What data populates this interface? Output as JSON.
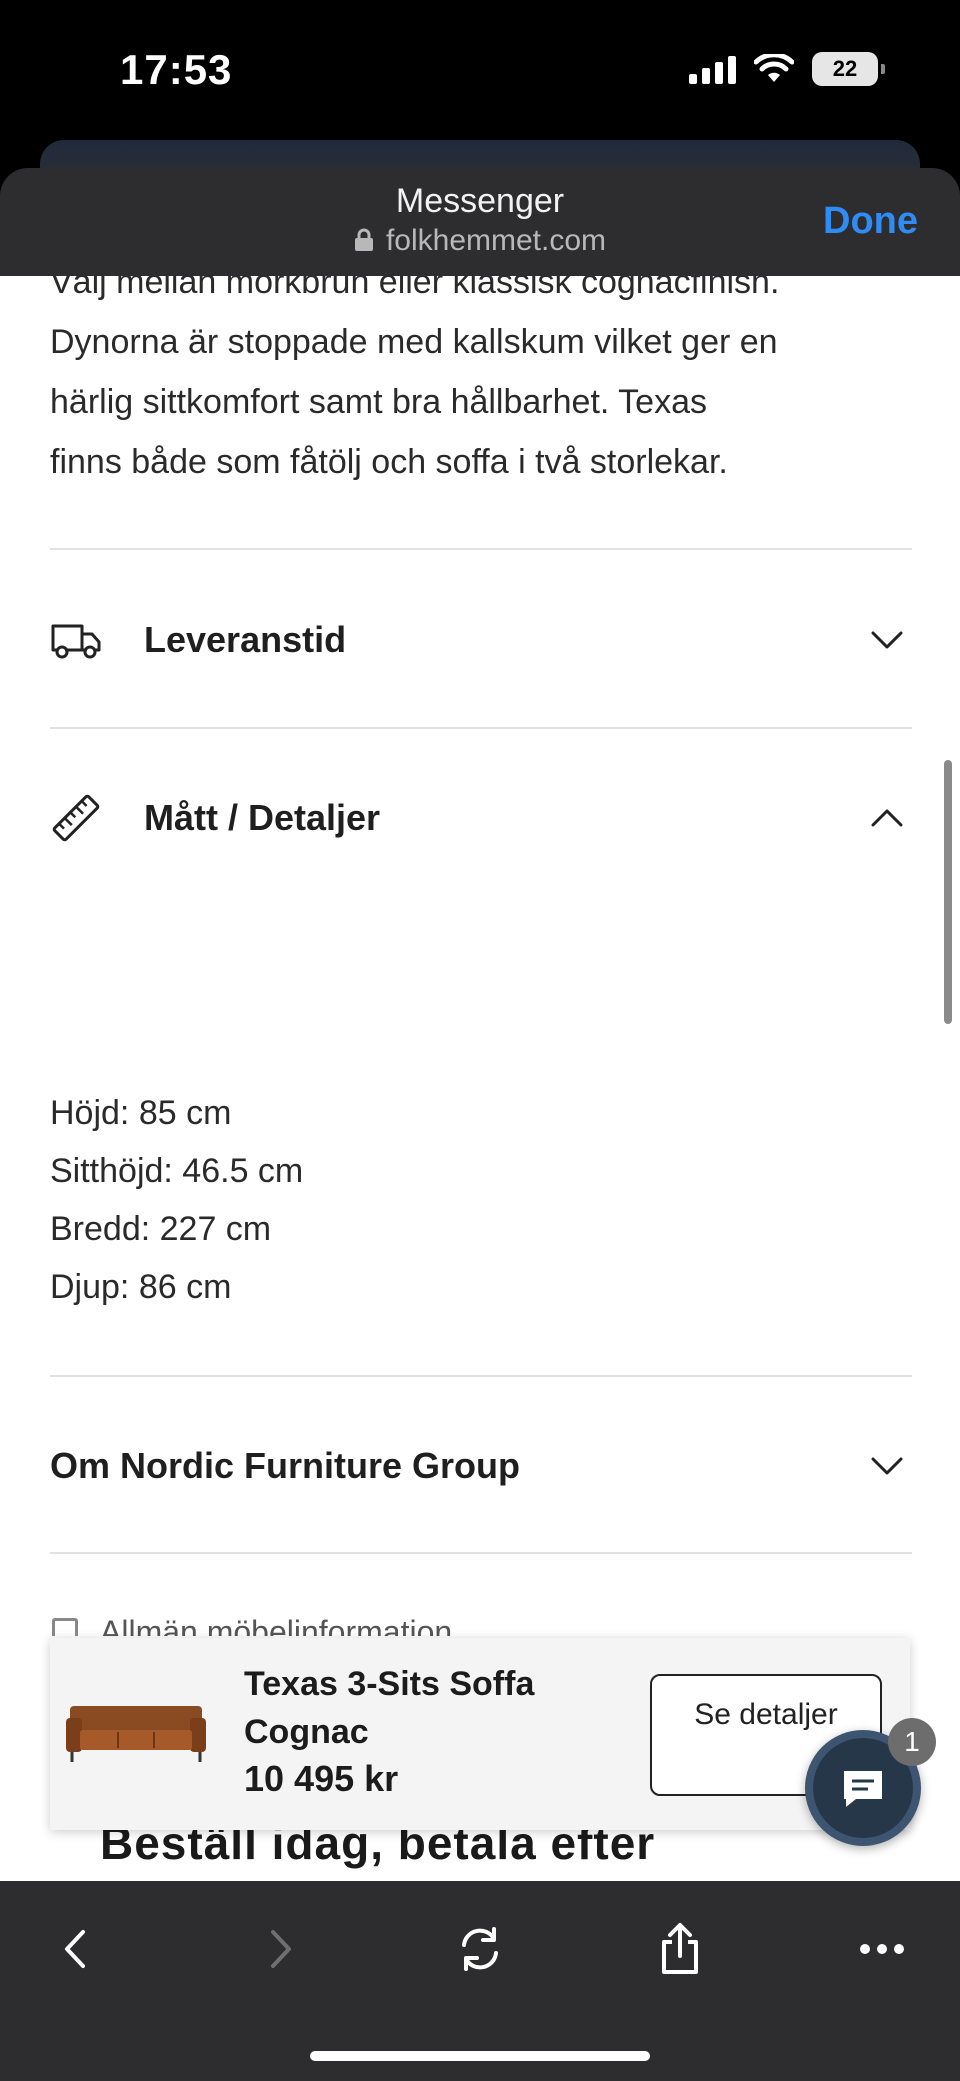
{
  "status_bar": {
    "time": "17:53",
    "battery": "22"
  },
  "browser_header": {
    "title": "Messenger",
    "url": "folkhemmet.com",
    "done_label": "Done"
  },
  "description": {
    "lines": [
      "Välj mellan mörkbrun eller klassisk cognacfinish.",
      "Dynorna är stoppade med kallskum vilket ger en",
      "härlig sittkomfort samt bra hållbarhet. Texas",
      "finns både som fåtölj och soffa i två storlekar."
    ]
  },
  "accordion": {
    "delivery": {
      "label": "Leveranstid",
      "icon": "truck-icon",
      "expanded": false
    },
    "dimensions": {
      "label": "Mått / Detaljer",
      "icon": "ruler-icon",
      "expanded": true
    },
    "about": {
      "label": "Om Nordic Furniture Group",
      "expanded": false
    }
  },
  "dimensions": [
    "Höjd: 85 cm",
    "Sitthöjd: 46.5 cm",
    "Bredd: 227 cm",
    "Djup: 86 cm"
  ],
  "partial_item": "Allmän möbelinformation",
  "promo_heading": "Beställ idag, betala efter",
  "product_card": {
    "name": "Texas 3-Sits Soffa Cognac",
    "price": "10 495 kr",
    "details_button": "Se detaljer"
  },
  "chat": {
    "badge_count": "1",
    "icon": "chat-icon"
  },
  "colors": {
    "accent": "#2f8cf5",
    "toolbar": "#2d2d2f",
    "chat": "#26374a"
  }
}
